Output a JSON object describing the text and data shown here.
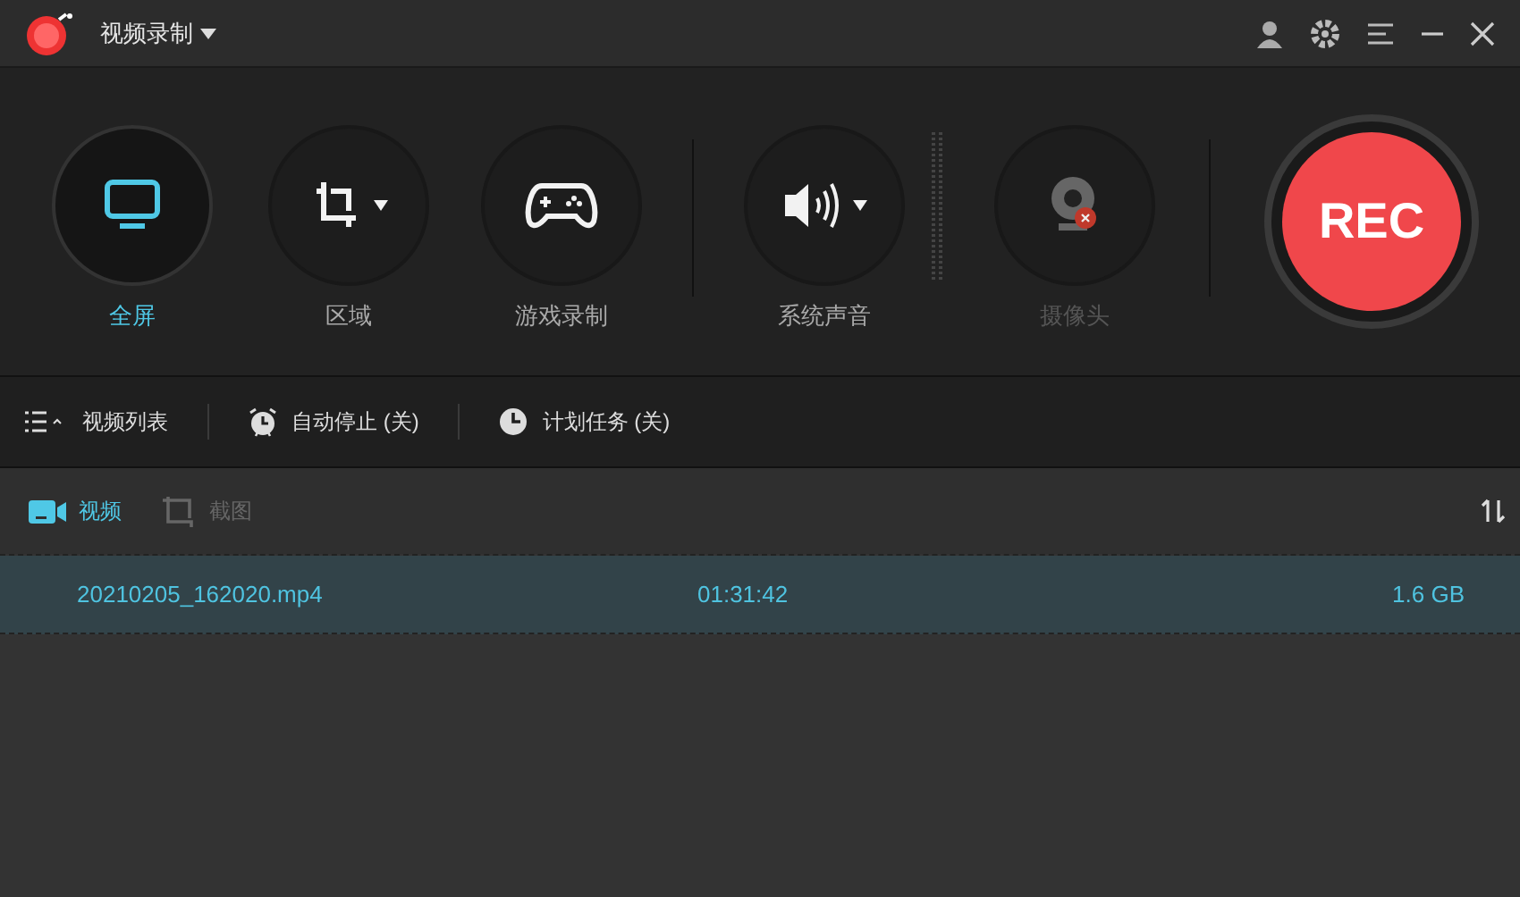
{
  "window": {
    "title": "视频录制"
  },
  "modes": [
    {
      "kind": "screen",
      "label": "全屏",
      "selected": true,
      "disabled": false,
      "dropdown": false
    },
    {
      "kind": "region",
      "label": "区域",
      "selected": false,
      "disabled": false,
      "dropdown": true
    },
    {
      "kind": "game",
      "label": "游戏录制",
      "selected": false,
      "disabled": false,
      "dropdown": false
    },
    {
      "kind": "sound",
      "label": "系统声音",
      "selected": false,
      "disabled": false,
      "dropdown": true
    },
    {
      "kind": "camera",
      "label": "摄像头",
      "selected": false,
      "disabled": true,
      "dropdown": false
    }
  ],
  "rec_button": {
    "label": "REC"
  },
  "bottom_toolbar": [
    {
      "kind": "list",
      "label": "视频列表"
    },
    {
      "kind": "alarm",
      "label": "自动停止 (关)"
    },
    {
      "kind": "clock",
      "label": "计划任务 (关)"
    }
  ],
  "media_tabs": [
    {
      "kind": "video",
      "label": "视频",
      "selected": true
    },
    {
      "kind": "screenshot",
      "label": "截图",
      "selected": false
    }
  ],
  "files": [
    {
      "name": "20210205_162020.mp4",
      "duration": "01:31:42",
      "size": "1.6 GB",
      "selected": true
    }
  ]
}
